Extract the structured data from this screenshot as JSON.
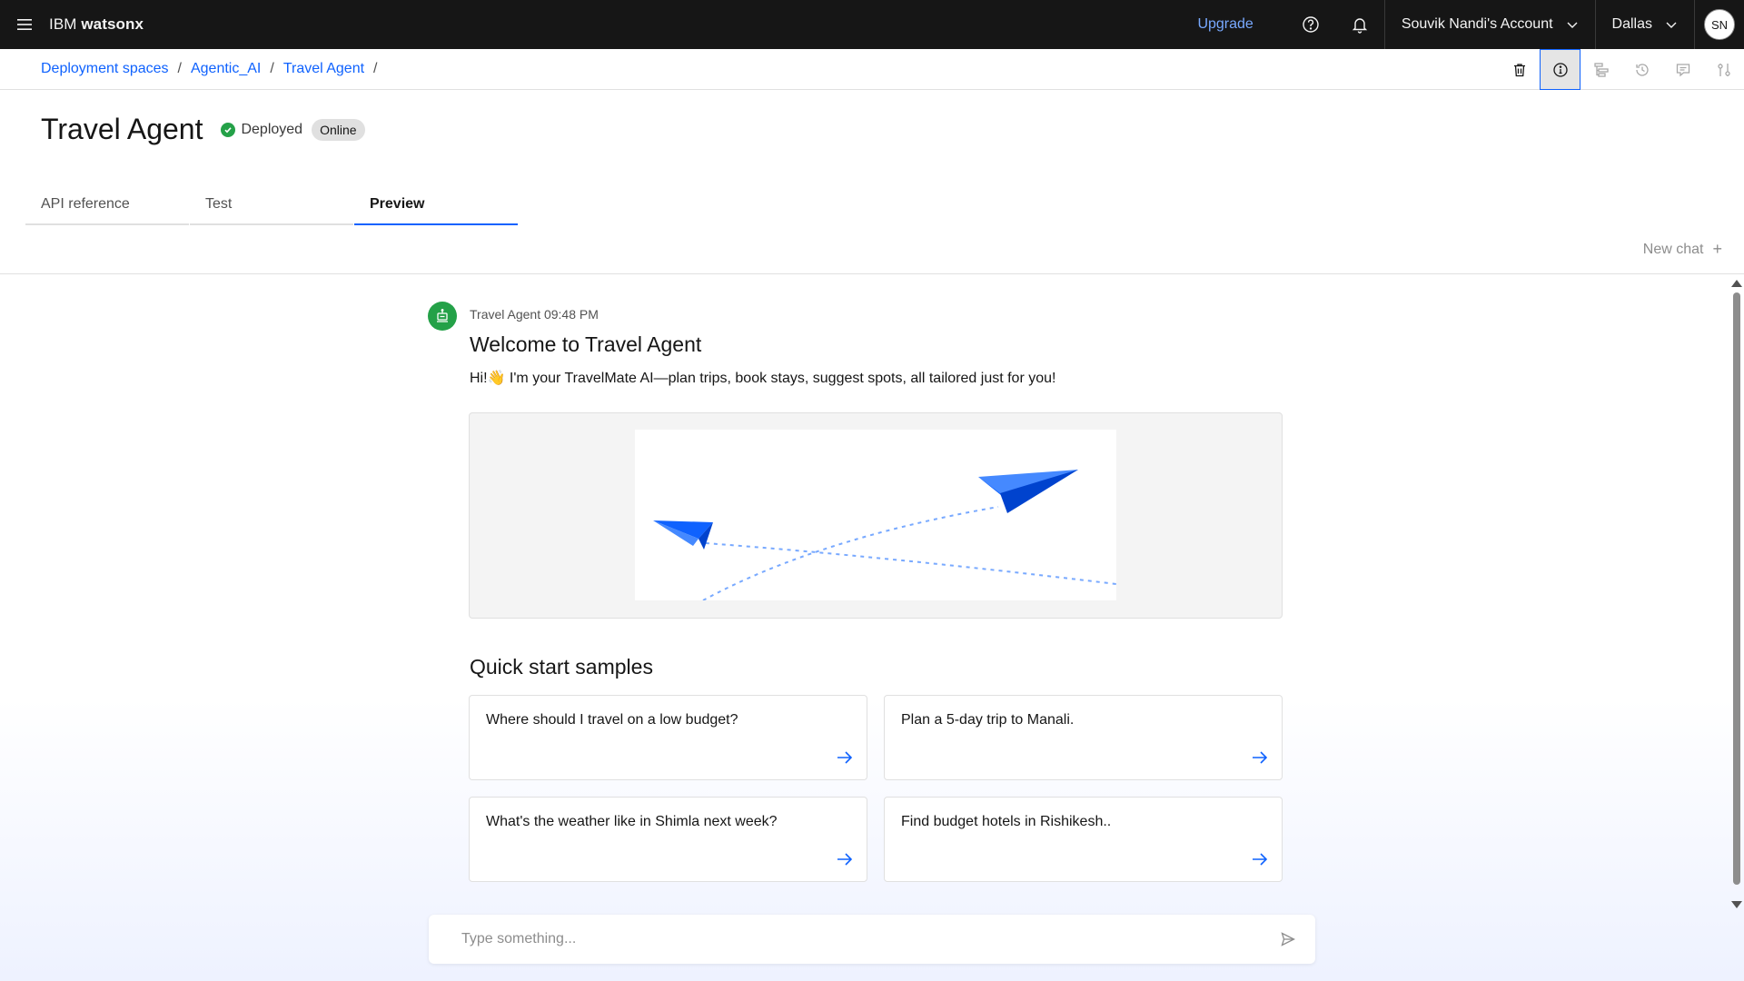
{
  "header": {
    "brand_prefix": "IBM",
    "brand_name": "watsonx",
    "upgrade_label": "Upgrade",
    "account_label": "Souvik Nandi's Account",
    "region_label": "Dallas",
    "avatar_initials": "SN"
  },
  "breadcrumb": {
    "items": [
      "Deployment spaces",
      "Agentic_AI",
      "Travel Agent"
    ],
    "separator": "/"
  },
  "page": {
    "title": "Travel Agent",
    "status_label": "Deployed",
    "tag_label": "Online"
  },
  "tabs": [
    {
      "label": "API reference",
      "selected": false
    },
    {
      "label": "Test",
      "selected": false
    },
    {
      "label": "Preview",
      "selected": true
    }
  ],
  "chat": {
    "new_chat_label": "New chat",
    "sender": "Travel Agent 09:48 PM",
    "welcome_title": "Welcome to Travel Agent",
    "intro_text": "Hi!👋 I'm your TravelMate AI—plan trips, book stays, suggest spots, all tailored just for you!",
    "quick_start_title": "Quick start samples",
    "samples": [
      "Where should I travel on a low budget?",
      "Plan a 5-day trip to Manali.",
      "What's the weather like in Shimla next week?",
      "Find budget hotels in Rishikesh.."
    ],
    "input_placeholder": "Type something..."
  },
  "colors": {
    "accent": "#0f62fe",
    "status_green": "#24a148",
    "header_bg": "#161616",
    "upgrade": "#78a9ff"
  }
}
